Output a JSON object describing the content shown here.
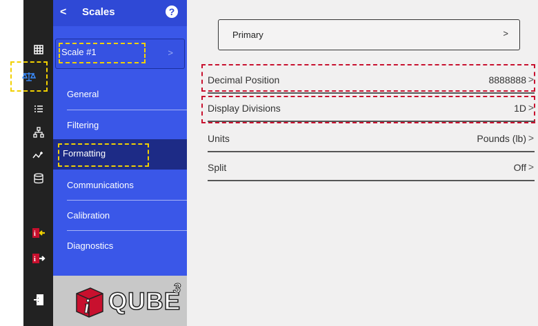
{
  "rail": {
    "icons": [
      "grid-icon",
      "scale-icon",
      "list-icon",
      "network-icon",
      "signal-icon",
      "database-icon",
      "import-icon",
      "export-icon",
      "logout-icon"
    ]
  },
  "menu": {
    "back_glyph": "<",
    "title": "Scales",
    "help_glyph": "?",
    "scale_item": "Scale #1",
    "scale_chevron": ">",
    "items": [
      {
        "label": "General"
      },
      {
        "label": "Filtering"
      },
      {
        "label": "Formatting"
      },
      {
        "label": "Communications"
      },
      {
        "label": "Calibration"
      },
      {
        "label": "Diagnostics"
      }
    ],
    "active_item": "Formatting"
  },
  "logo": {
    "text": "QUBE",
    "superscript": "3"
  },
  "content": {
    "primary_label": "Primary",
    "chevron": ">",
    "rows": [
      {
        "label": "Decimal Position",
        "value": "8888888"
      },
      {
        "label": "Display Divisions",
        "value": "1D"
      },
      {
        "label": "Units",
        "value": "Pounds (lb)"
      },
      {
        "label": "Split",
        "value": "Off"
      }
    ]
  },
  "colors": {
    "rail": "#222222",
    "menu_blue": "#3a57e8",
    "menu_active": "#1d2b86",
    "content_bg": "#f1f0f0",
    "highlight_yellow": "#f2d100",
    "highlight_red": "#c8102e"
  }
}
